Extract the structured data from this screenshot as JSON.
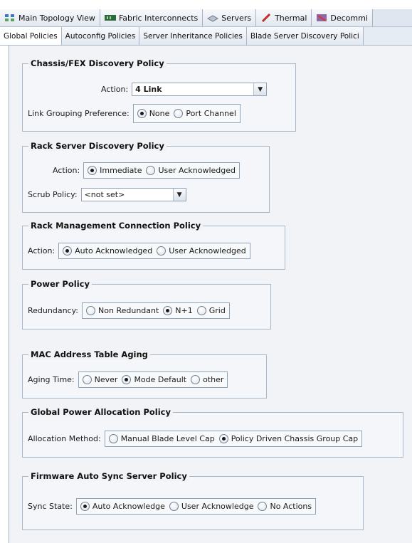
{
  "tabs_main": [
    {
      "label": "Main Topology View",
      "icon": "topology-icon"
    },
    {
      "label": "Fabric Interconnects",
      "icon": "fabric-interconnect-icon"
    },
    {
      "label": "Servers",
      "icon": "servers-icon"
    },
    {
      "label": "Thermal",
      "icon": "thermal-icon"
    },
    {
      "label": "Decommi",
      "icon": "decommission-icon"
    }
  ],
  "tabs_sub": [
    {
      "label": "Global Policies",
      "active": true
    },
    {
      "label": "Autoconfig Policies"
    },
    {
      "label": "Server Inheritance Policies"
    },
    {
      "label": "Blade Server Discovery Polici"
    }
  ],
  "chassis": {
    "title": "Chassis/FEX Discovery Policy",
    "action_label": "Action:",
    "action_value": "4 Link",
    "grouping_label": "Link Grouping Preference:",
    "options": [
      "None",
      "Port Channel"
    ],
    "selected": 0
  },
  "rack_discovery": {
    "title": "Rack Server Discovery Policy",
    "action_label": "Action:",
    "options": [
      "Immediate",
      "User Acknowledged"
    ],
    "selected": 0,
    "scrub_label": "Scrub Policy:",
    "scrub_value": "<not set>"
  },
  "rack_mgmt": {
    "title": "Rack Management Connection Policy",
    "action_label": "Action:",
    "options": [
      "Auto Acknowledged",
      "User Acknowledged"
    ],
    "selected": 0
  },
  "power": {
    "title": "Power Policy",
    "label": "Redundancy:",
    "options": [
      "Non Redundant",
      "N+1",
      "Grid"
    ],
    "selected": 1
  },
  "mac": {
    "title": "MAC Address Table Aging",
    "label": "Aging Time:",
    "options": [
      "Never",
      "Mode Default",
      "other"
    ],
    "selected": 1
  },
  "alloc": {
    "title": "Global Power Allocation Policy",
    "label": "Allocation Method:",
    "options": [
      "Manual Blade Level Cap",
      "Policy Driven Chassis Group Cap"
    ],
    "selected": 1
  },
  "firmware": {
    "title": "Firmware Auto Sync Server Policy",
    "label": "Sync State:",
    "options": [
      "Auto Acknowledge",
      "User Acknowledge",
      "No Actions"
    ],
    "selected": 0
  }
}
